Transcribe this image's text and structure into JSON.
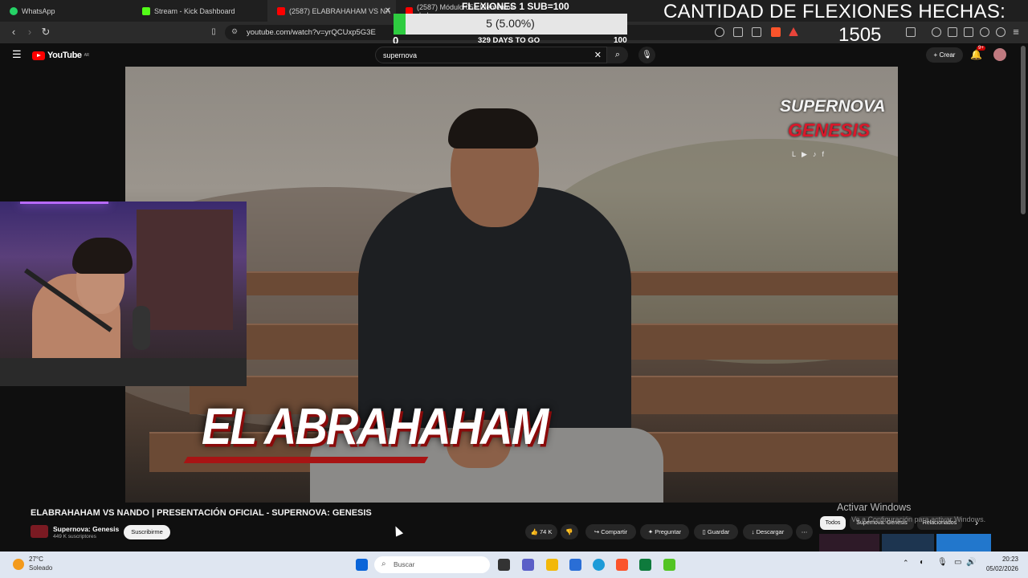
{
  "browser": {
    "tabs": [
      {
        "label": "WhatsApp",
        "icon": "whatsapp-icon",
        "color": "#25d366"
      },
      {
        "label": "Stream - Kick Dashboard",
        "icon": "kick-icon",
        "color": "#53fc18"
      },
      {
        "label": "(2587) ELABRAHAHAM VS NA",
        "icon": "youtube-icon",
        "color": "#ff0000"
      },
      {
        "label": "(2587) Módulo 05 - Elementos de l",
        "icon": "youtube-icon",
        "color": "#ff0000"
      }
    ],
    "url": "youtube.com/watch?v=yrQCUxp5G3E"
  },
  "overlay": {
    "counter_title": "FLEXIONES 1 SUB=100",
    "progress_text": "5 (5.00%)",
    "progress_value": 0.05,
    "progress_min": "0",
    "days_to_go": "329 DAYS TO GO",
    "progress_max": "100",
    "flexiones_title": "CANTIDAD DE FLEXIONES HECHAS:",
    "flexiones_count": "1505"
  },
  "youtube": {
    "logo_text": "YouTube",
    "logo_region": "AR",
    "search_value": "supernova",
    "create_label": "Crear",
    "notif_count": "9+"
  },
  "video": {
    "brand_line1": "SUPERNOVA",
    "brand_line2": "GENESIS",
    "name_overlay": "EL ABRAHAHAM",
    "title": "ELABRAHAHAM VS NANDO | PRESENTACIÓN OFICIAL - SUPERNOVA: GENESIS",
    "channel": "Supernova: Genesis",
    "subscribers": "449 K suscriptores",
    "subscribe_label": "Suscribirme",
    "likes": "74 K",
    "share_label": "Compartir",
    "ask_label": "Preguntar",
    "save_label": "Guardar",
    "download_label": "Descargar"
  },
  "chips": {
    "all": "Todos",
    "channel": "Supernova: Genesis",
    "related": "Relacionados"
  },
  "watermark": {
    "line1": "Activar Windows",
    "line2": "Ve a Configuración para activar Windows."
  },
  "taskbar": {
    "temp": "27°C",
    "weather": "Soleado",
    "search_placeholder": "Buscar",
    "time": "20:23",
    "date": "05/02/2026"
  },
  "colors": {
    "progress_fill": "#2ecc40",
    "youtube_red": "#ff0000",
    "brand_red": "#d8192b"
  }
}
